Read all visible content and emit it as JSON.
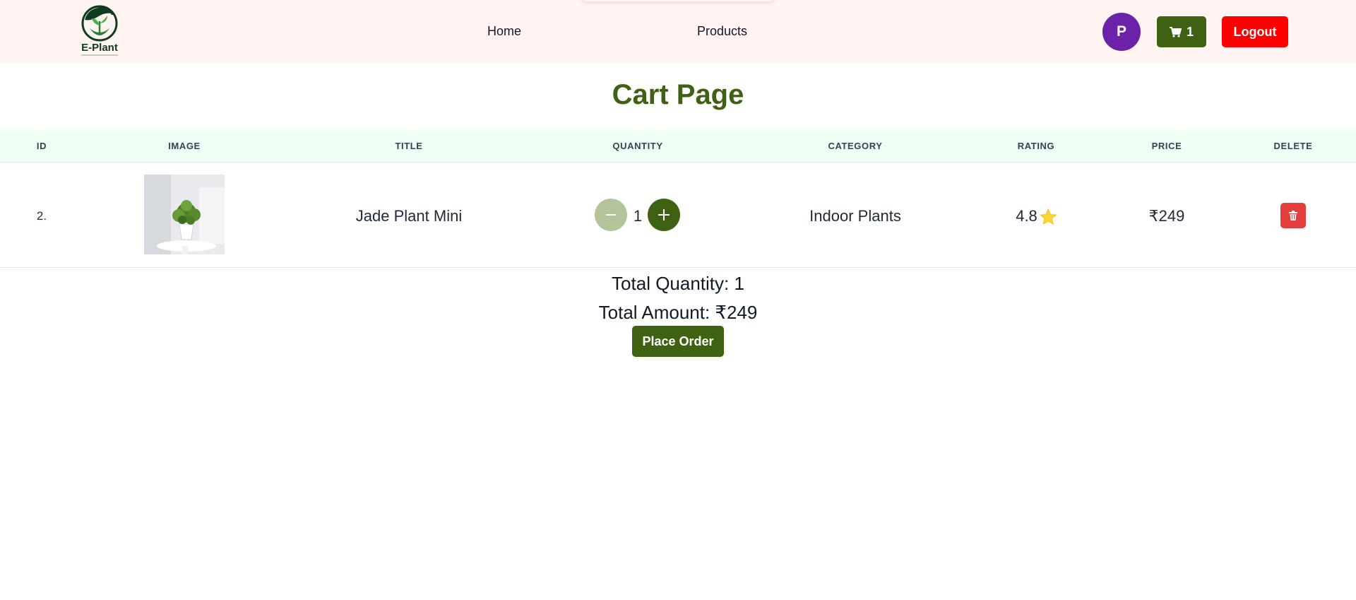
{
  "header": {
    "logo_text": "E-Plant",
    "nav": {
      "home": "Home",
      "products": "Products"
    },
    "avatar_initial": "P",
    "cart_count": "1",
    "logout_label": "Logout"
  },
  "page": {
    "title": "Cart Page"
  },
  "table": {
    "columns": [
      "ID",
      "IMAGE",
      "TITLE",
      "QUANTITY",
      "CATEGORY",
      "RATING",
      "PRICE",
      "DELETE"
    ],
    "rows": [
      {
        "id": "2.",
        "image_alt": "potted-plant-photo",
        "title": "Jade Plant Mini",
        "quantity": "1",
        "category": "Indoor Plants",
        "rating": "4.8",
        "price": "₹249"
      }
    ]
  },
  "summary": {
    "total_quantity": "Total Quantity: 1",
    "total_amount": "Total Amount: ₹249",
    "place_order_label": "Place Order"
  },
  "colors": {
    "header_bg": "#fff4f2",
    "brand_green": "#3f6212",
    "minus_disabled": "#b3c49b",
    "avatar": "#6b21a8",
    "logout": "#ff0000",
    "delete": "#e53e3e",
    "star": "#fcd535",
    "table_head_bg": "#effff3"
  },
  "icons": {
    "cart": "cart-icon",
    "minus": "minus-icon",
    "plus": "plus-icon",
    "star": "star-icon",
    "trash": "trash-icon"
  }
}
